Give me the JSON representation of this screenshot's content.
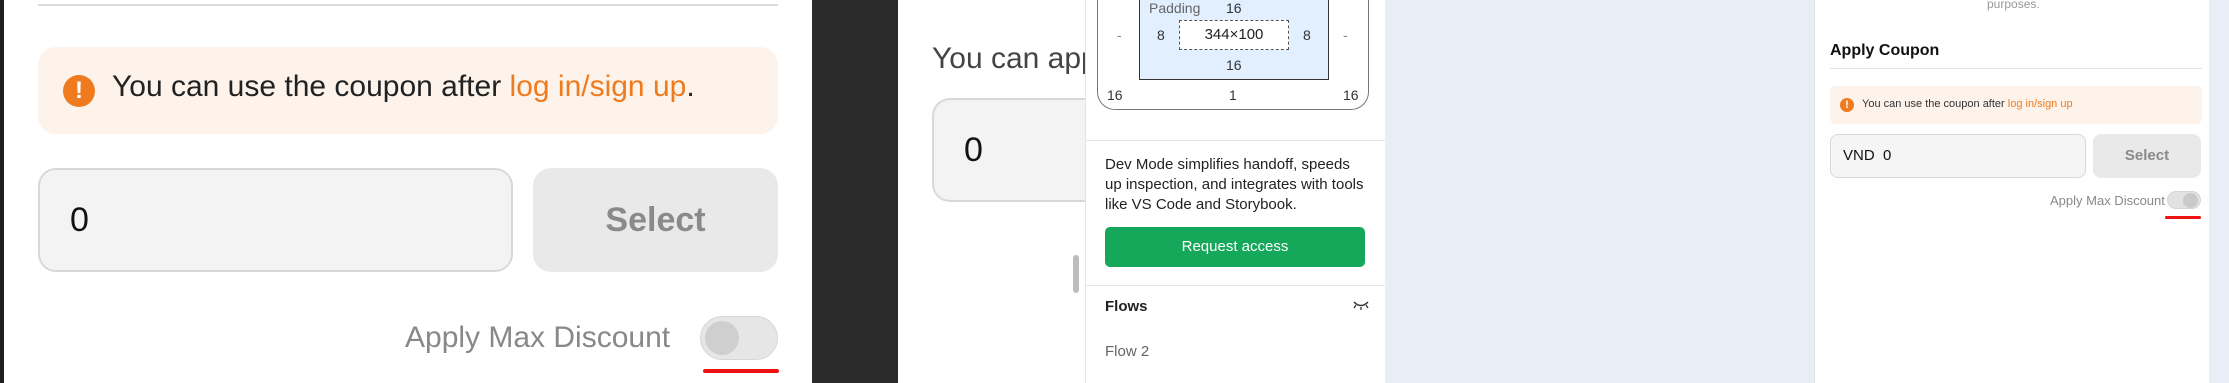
{
  "coupon_zoom": {
    "alert_prefix": "You can use the coupon after ",
    "alert_link": "log in/sign up",
    "alert_suffix": ".",
    "amount_value": "0",
    "select_label": "Select",
    "max_discount_label": "Apply Max Discount"
  },
  "background_partial": {
    "text": "You can app",
    "amount_value": "0"
  },
  "dev_panel": {
    "box_label_padding": "Padding",
    "padding_top": "16",
    "padding_left": "8",
    "padding_right": "8",
    "padding_bottom": "16",
    "dash_left": "-",
    "dash_right": "-",
    "size": "344×100",
    "margin_left": "16",
    "margin_center": "1",
    "margin_right": "16",
    "description": "Dev Mode simplifies handoff, speeds up inspection, and integrates with tools like VS Code and Storybook.",
    "request_button": "Request access",
    "flows_title": "Flows",
    "flow_item": "Flow 2"
  },
  "coupon_preview": {
    "top_text": "purposes.",
    "title": "Apply Coupon",
    "alert_prefix": "You can use the coupon after ",
    "alert_link": "log in/sign up",
    "currency": "VND",
    "amount_value": "0",
    "select_label": "Select",
    "max_discount_label": "Apply Max Discount"
  },
  "colors": {
    "accent_orange": "#f07b1e",
    "request_green": "#15a85a",
    "highlight_red": "#ee1111"
  }
}
